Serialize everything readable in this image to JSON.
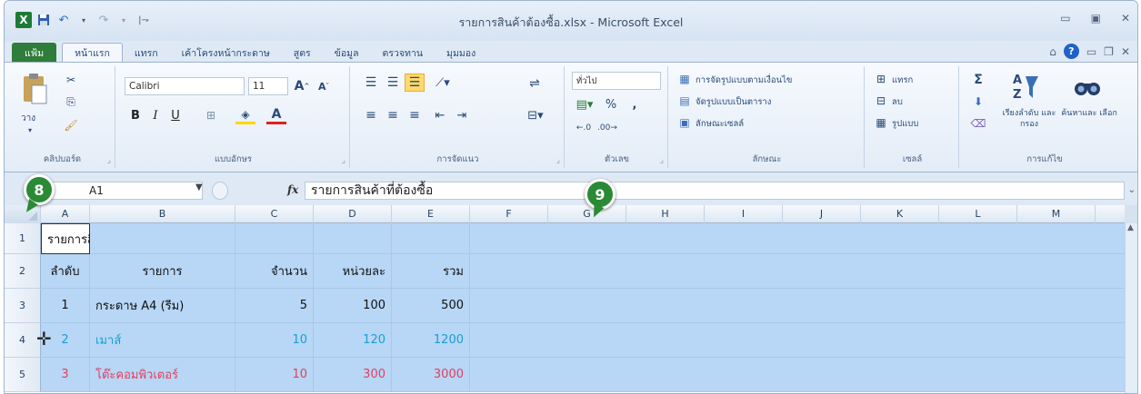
{
  "window": {
    "title": "รายการสินค้าต้องซื้อ.xlsx - Microsoft Excel",
    "app_icon_letter": "X"
  },
  "tabs": [
    "แฟ้ม",
    "หน้าแรก",
    "แทรก",
    "เค้าโครงหน้ากระดาษ",
    "สูตร",
    "ข้อมูล",
    "ตรวจทาน",
    "มุมมอง"
  ],
  "ribbon": {
    "clipboard": {
      "label": "คลิปบอร์ด",
      "paste_label": "วาง"
    },
    "font": {
      "label": "แบบอักษร",
      "font_name": "Calibri",
      "font_size": "11",
      "bold": "B",
      "italic": "I",
      "underline": "U"
    },
    "alignment": {
      "label": "การจัดแนว"
    },
    "number": {
      "label": "ตัวเลข",
      "format": "ทั่วไป",
      "percent": "%",
      "comma": ","
    },
    "styles": {
      "label": "ลักษณะ",
      "items": [
        "การจัดรูปแบบตามเงื่อนไข",
        "จัดรูปแบบเป็นตาราง",
        "ลักษณะเซลล์"
      ]
    },
    "cells": {
      "label": "เซลล์",
      "items": [
        "แทรก",
        "ลบ",
        "รูปแบบ"
      ]
    },
    "editing": {
      "label": "การแก้ไข",
      "sort": "เรียงลำดับ และกรอง",
      "find": "ค้นหาและ เลือก",
      "sigma": "Σ"
    }
  },
  "formula_bar": {
    "name_box": "A1",
    "fx": "fx",
    "content": "รายการสินค้าที่ต้องซื้อ"
  },
  "callouts": {
    "a": "8",
    "b": "9"
  },
  "columns": [
    "A",
    "B",
    "C",
    "D",
    "E",
    "F",
    "G",
    "H",
    "I",
    "J",
    "K",
    "L",
    "M"
  ],
  "rows": [
    {
      "num": "1",
      "cells": [
        "รายการสินค้าที่ต้องซื้อ",
        "",
        "",
        "",
        ""
      ]
    },
    {
      "num": "2",
      "cells": [
        "ลำดับ",
        "รายการ",
        "จำนวน",
        "หน่วยละ",
        "รวม"
      ]
    },
    {
      "num": "3",
      "cells": [
        "1",
        "กระดาษ  A4 (รีม)",
        "5",
        "100",
        "500"
      ]
    },
    {
      "num": "4",
      "cells": [
        "2",
        "เมาส์",
        "10",
        "120",
        "1200"
      ]
    },
    {
      "num": "5",
      "cells": [
        "3",
        "โต๊ะคอมพิวเตอร์",
        "10",
        "300",
        "3000"
      ]
    }
  ],
  "colors": {
    "selection": "#b8d6f5",
    "accent_green": "#2a8a35",
    "row4_text": "#1a9fd0",
    "row5_text": "#e04060"
  }
}
